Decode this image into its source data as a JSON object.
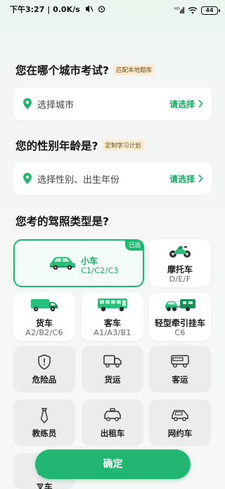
{
  "status_bar": {
    "time": "下午3:27",
    "speed": "0.0K/s",
    "battery": "44",
    "network_icon": "signal-hd-icon",
    "wifi_icon": "wifi-icon"
  },
  "city": {
    "title": "您在哪个城市考试?",
    "tag": "匹配本地题库",
    "placeholder": "选择城市",
    "action": "请选择"
  },
  "gender_age": {
    "title": "您的性别年龄是?",
    "tag": "定制学习计划",
    "placeholder": "选择性别、出生年份",
    "action": "请选择"
  },
  "license": {
    "title": "您考的驾照类型是?",
    "selected_badge": "已选",
    "types": [
      {
        "name": "小车",
        "sub": "C1/C2/C3",
        "icon": "car-icon",
        "selected": true
      },
      {
        "name": "摩托车",
        "sub": "D/E/F",
        "icon": "motorcycle-icon",
        "selected": false
      },
      {
        "name": "货车",
        "sub": "A2/B2/C6",
        "icon": "truck-icon",
        "selected": false
      },
      {
        "name": "客车",
        "sub": "A1/A3/B1",
        "icon": "bus-icon",
        "selected": false
      },
      {
        "name": "轻型牵引挂车",
        "sub": "C6",
        "icon": "trailer-icon",
        "selected": false
      }
    ],
    "others": [
      {
        "name": "危险品",
        "icon": "hazard-shield-icon"
      },
      {
        "name": "货运",
        "icon": "freight-truck-icon"
      },
      {
        "name": "客运",
        "icon": "coach-bus-icon"
      },
      {
        "name": "教练员",
        "icon": "coach-tie-icon"
      },
      {
        "name": "出租车",
        "icon": "taxi-icon"
      },
      {
        "name": "网约车",
        "icon": "ride-hailing-car-icon"
      },
      {
        "name": "叉车",
        "icon": "forklift-icon"
      }
    ]
  },
  "confirm_label": "确定",
  "colors": {
    "accent": "#22b673",
    "tag_bg": "#fbecd4",
    "selected_bg": "#f2fbf6"
  }
}
